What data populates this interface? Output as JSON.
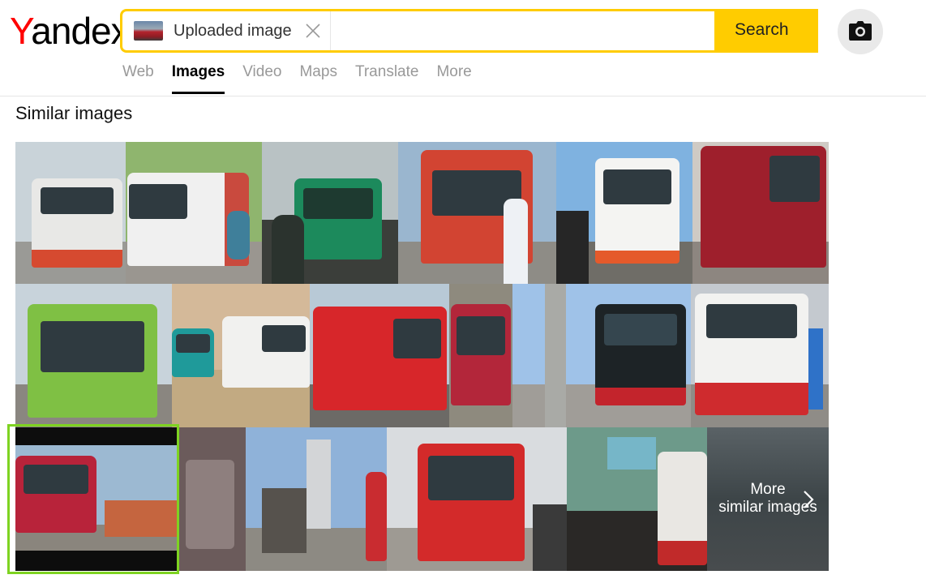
{
  "logo": {
    "first_letter": "Y",
    "rest": "andex"
  },
  "search": {
    "chip_label": "Uploaded image",
    "query": "",
    "button_label": "Search"
  },
  "nav": {
    "items": [
      {
        "label": "Web",
        "active": false
      },
      {
        "label": "Images",
        "active": true
      },
      {
        "label": "Video",
        "active": false
      },
      {
        "label": "Maps",
        "active": false
      },
      {
        "label": "Translate",
        "active": false
      },
      {
        "label": "More",
        "active": false
      }
    ]
  },
  "results": {
    "title": "Similar images",
    "more_line1": "More",
    "more_line2": "similar images"
  },
  "icons": {
    "clear": "close-icon",
    "camera": "camera-icon",
    "more": "chevron-right-icon"
  },
  "colors": {
    "accent": "#ffcc00",
    "logo_red": "#ff0000",
    "selected_border": "#7ed321"
  }
}
